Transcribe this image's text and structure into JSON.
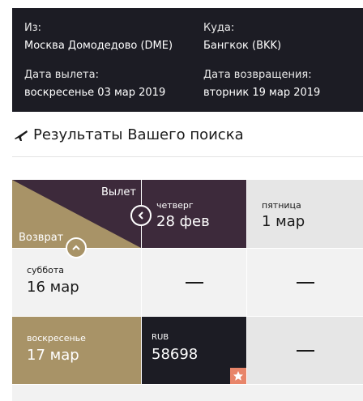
{
  "summary": {
    "from_label": "Из:",
    "from_value": "Москва Домодедово (DME)",
    "to_label": "Куда:",
    "to_value": "Бангкок (BKK)",
    "departure_label": "Дата вылета:",
    "departure_value": "воскресенье 03 мар 2019",
    "return_label": "Дата возвращения:",
    "return_value": "вторник 19 мар 2019"
  },
  "results": {
    "heading": "Результаты Вашего поиска"
  },
  "matrix": {
    "corner_departure_label": "Вылет",
    "corner_return_label": "Возврат",
    "departure_dates": [
      {
        "day": "четверг",
        "date": "28 фев"
      },
      {
        "day": "пятница",
        "date": "1 мар"
      }
    ],
    "return_dates": [
      {
        "day": "суббота",
        "date": "16 мар"
      },
      {
        "day": "воскресенье",
        "date": "17 мар"
      }
    ],
    "best_price": {
      "currency": "RUB",
      "amount": "58698"
    },
    "empty_mark": "—"
  },
  "colors": {
    "dark": "#1c1c24",
    "plum": "#3d2a3b",
    "gold": "#a89367",
    "star": "#e8856a"
  }
}
